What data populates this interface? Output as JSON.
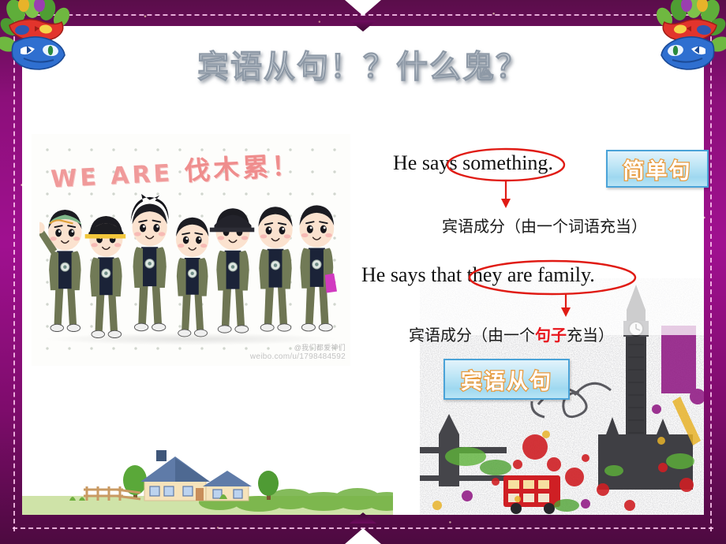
{
  "slide": {
    "title": "宾语从句！？什么鬼？",
    "theme": {
      "frame_color": "#8c0f7a",
      "page_color": "#ffffff",
      "highlight_red": "#e8161d",
      "tag_border": "#4aa3d8",
      "tag_text_outline": "#e89a3c"
    }
  },
  "photo": {
    "name": "we-are-family-cartoon",
    "headline_en": "WE ARE",
    "headline_cn": "伐木累！",
    "watermark_line1": "@我们都爱神们",
    "watermark_line2": "weibo.com/u/1798484592",
    "figure_count": 7
  },
  "examples": [
    {
      "id": "simple-sentence",
      "english_prefix": "He says ",
      "english_circled": "something",
      "english_suffix": ".",
      "annotation": "宾语成分（由一个词语充当）",
      "annotation_prefix": "宾语成分（由一个",
      "annotation_highlight": "",
      "annotation_suffix": "词语充当）",
      "tag": "简单句"
    },
    {
      "id": "object-clause",
      "english_prefix": "He says that ",
      "english_circled": "they are family",
      "english_suffix": ".",
      "annotation": "宾语成分（由一个句子充当）",
      "annotation_prefix": "宾语成分（由一个",
      "annotation_highlight": "句子",
      "annotation_suffix": "充当）",
      "tag": "宾语从句"
    }
  ],
  "decor": {
    "corner_icon": "carnival-mask",
    "bottom_left_icon": "countryside-house",
    "bottom_right_icon": "london-big-ben-grunge"
  }
}
